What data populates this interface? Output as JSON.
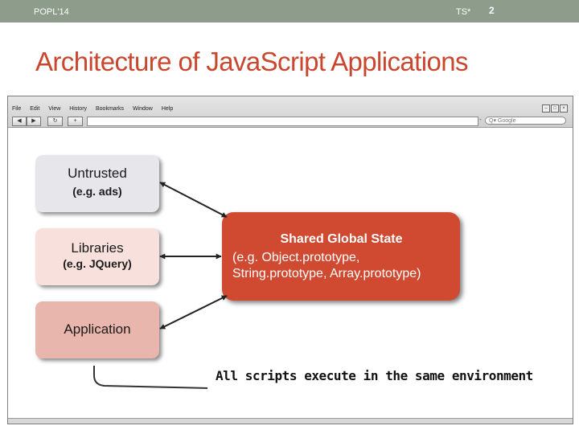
{
  "header": {
    "conference": "POPL'14",
    "author": "TS*",
    "page": "2"
  },
  "slide": {
    "title": "Architecture of JavaScript Applications"
  },
  "browser": {
    "menu": [
      "File",
      "Edit",
      "View",
      "History",
      "Bookmarks",
      "Window",
      "Help"
    ],
    "search_placeholder": "Google",
    "nav_icons": [
      "back-arrow-icon",
      "forward-arrow-icon",
      "reload-icon",
      "add-tab-icon"
    ],
    "window_icons": [
      "minimize-icon",
      "maximize-icon",
      "close-icon"
    ]
  },
  "diagram": {
    "untrusted": {
      "title": "Untrusted",
      "sub": "(e.g. ads)"
    },
    "libraries": {
      "title": "Libraries",
      "sub": "(e.g. JQuery)"
    },
    "application": {
      "title": "Application"
    },
    "shared": {
      "title": "Shared Global State",
      "line1": "(e.g. Object.prototype,",
      "line2": "String.prototype, Array.prototype)"
    },
    "caption": "All scripts execute in the same environment",
    "colors": {
      "title": "#c9472e",
      "shared_fill": "#d04a32",
      "untrusted_fill": "#e7e6ea",
      "libraries_fill": "#f8e1dc",
      "application_fill": "#e9b6ad",
      "header_bar": "#8d9c8b"
    }
  }
}
